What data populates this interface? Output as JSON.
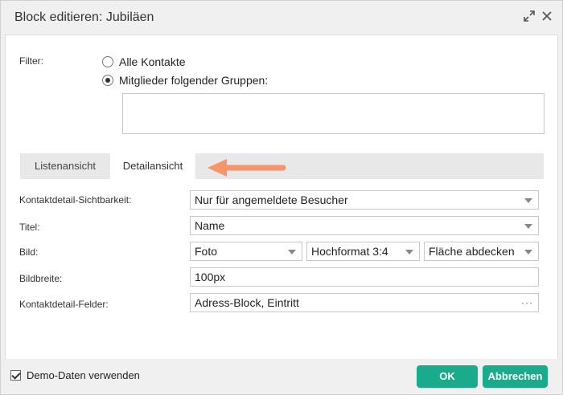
{
  "dialog": {
    "title": "Block editieren: Jubiläen"
  },
  "filter": {
    "label": "Filter:",
    "options": [
      {
        "label": "Alle Kontakte",
        "selected": false
      },
      {
        "label": "Mitglieder folgender Gruppen:",
        "selected": true
      }
    ],
    "groups_value": ""
  },
  "tabs": [
    {
      "label": "Listenansicht",
      "active": false
    },
    {
      "label": "Detailansicht",
      "active": true
    }
  ],
  "form": {
    "visibility": {
      "label": "Kontaktdetail-Sichtbarkeit:",
      "value": "Nur für angemeldete Besucher"
    },
    "title": {
      "label": "Titel:",
      "value": "Name"
    },
    "image": {
      "label": "Bild:",
      "source": "Foto",
      "format": "Hochformat 3:4",
      "fit": "Fläche abdecken"
    },
    "image_width": {
      "label": "Bildbreite:",
      "value": "100px"
    },
    "fields": {
      "label": "Kontaktdetail-Felder:",
      "value": "Adress-Block, Eintritt",
      "more": "···"
    }
  },
  "footer": {
    "demo_data_label": "Demo-Daten verwenden",
    "demo_data_checked": true,
    "ok_label": "OK",
    "cancel_label": "Abbrechen"
  },
  "colors": {
    "accent": "#1aaa8c",
    "annotation_arrow": "#f4956a"
  },
  "icons": {
    "expand": "expand-icon",
    "close": "close-icon"
  }
}
